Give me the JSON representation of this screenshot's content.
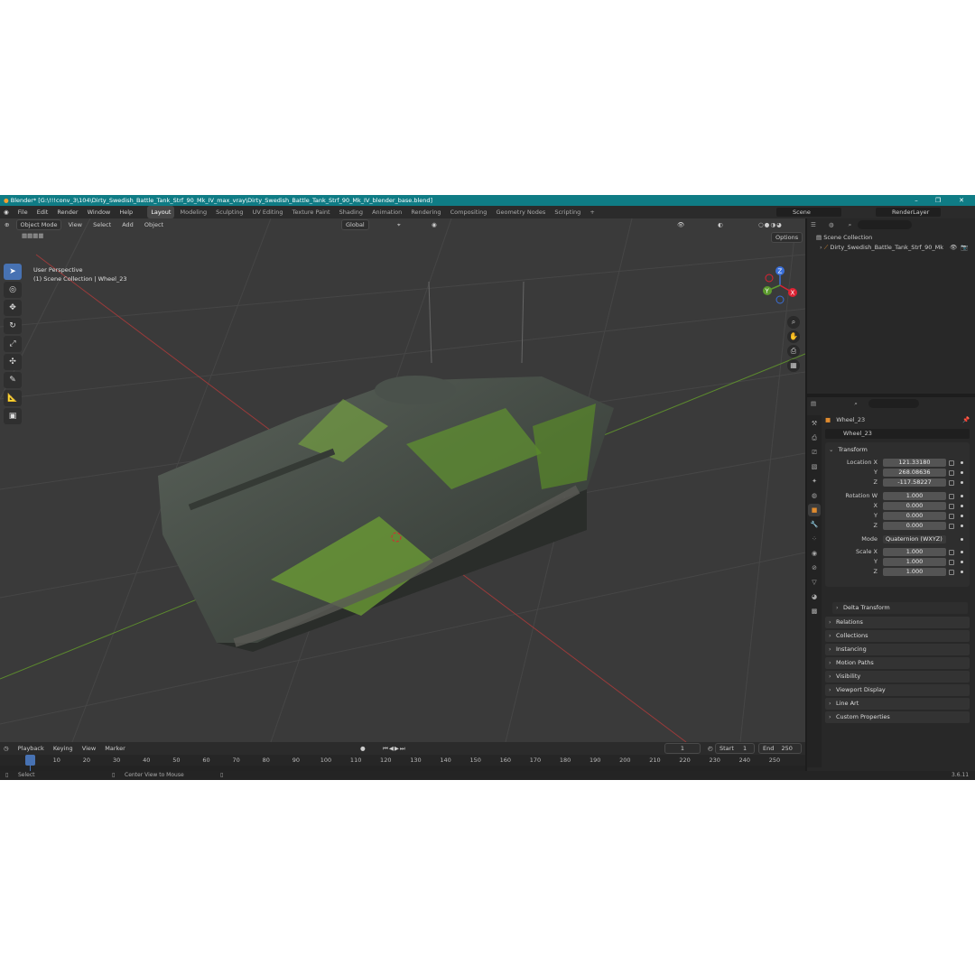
{
  "titlebar": {
    "title": "Blender* [G:\\!!!conv_3\\104\\Dirty_Swedish_Battle_Tank_Strf_90_Mk_IV_max_vray\\Dirty_Swedish_Battle_Tank_Strf_90_Mk_IV_blender_base.blend]",
    "minimize": "–",
    "maximize": "❐",
    "close": "✕"
  },
  "menu": {
    "items": [
      "File",
      "Edit",
      "Render",
      "Window",
      "Help"
    ],
    "workspaces": [
      "Layout",
      "Modeling",
      "Sculpting",
      "UV Editing",
      "Texture Paint",
      "Shading",
      "Animation",
      "Rendering",
      "Compositing",
      "Geometry Nodes",
      "Scripting"
    ],
    "active_workspace": "Layout",
    "add_workspace": "+",
    "scene_label": "Scene",
    "view_layer_label": "RenderLayer"
  },
  "viewport": {
    "mode": "Object Mode",
    "menus": [
      "View",
      "Select",
      "Add",
      "Object"
    ],
    "orientation": "Global",
    "options_label": "Options",
    "overlay_line1": "User Perspective",
    "overlay_line2": "(1) Scene Collection | Wheel_23",
    "gizmo_axes": {
      "x": "X",
      "y": "Y",
      "z": "Z"
    },
    "colors": {
      "grid_bg": "#3a3a3a",
      "x_axis": "#9b3a3a",
      "y_axis": "#5c8a2e",
      "accent": "#4772b3"
    }
  },
  "toolbar": {
    "tools": [
      "select-box",
      "cursor",
      "move",
      "rotate",
      "scale",
      "transform",
      "annotate",
      "measure",
      "add-cube"
    ]
  },
  "outliner": {
    "root": "Scene Collection",
    "item": "Dirty_Swedish_Battle_Tank_Strf_90_Mk"
  },
  "properties": {
    "object_name": "Wheel_23",
    "data_name": "Wheel_23",
    "transform_header": "Transform",
    "location_label": "Location X",
    "location": {
      "x": "121.33180",
      "y": "268.08636",
      "z": "-117.58227"
    },
    "rotation_label": "Rotation W",
    "rotation": {
      "w": "1.000",
      "x": "0.000",
      "y": "0.000",
      "z": "0.000"
    },
    "mode_label": "Mode",
    "mode_value": "Quaternion (WXYZ)",
    "scale_label": "Scale X",
    "scale": {
      "x": "1.000",
      "y": "1.000",
      "z": "1.000"
    },
    "axis_labels": {
      "x": "X",
      "y": "Y",
      "z": "Z"
    },
    "delta_transform": "Delta Transform",
    "panels": [
      "Relations",
      "Collections",
      "Instancing",
      "Motion Paths",
      "Visibility",
      "Viewport Display",
      "Line Art",
      "Custom Properties"
    ]
  },
  "timeline": {
    "menus": [
      "Playback",
      "Keying",
      "View",
      "Marker"
    ],
    "current_frame": "1",
    "start_label": "Start",
    "start": "1",
    "end_label": "End",
    "end": "250",
    "ticks": [
      "1",
      "10",
      "20",
      "30",
      "40",
      "50",
      "60",
      "70",
      "80",
      "90",
      "100",
      "110",
      "120",
      "130",
      "140",
      "150",
      "160",
      "170",
      "180",
      "190",
      "200",
      "210",
      "220",
      "230",
      "240",
      "250"
    ]
  },
  "statusbar": {
    "left": "Select",
    "middle": "Center View to Mouse",
    "version": "3.6.11"
  }
}
